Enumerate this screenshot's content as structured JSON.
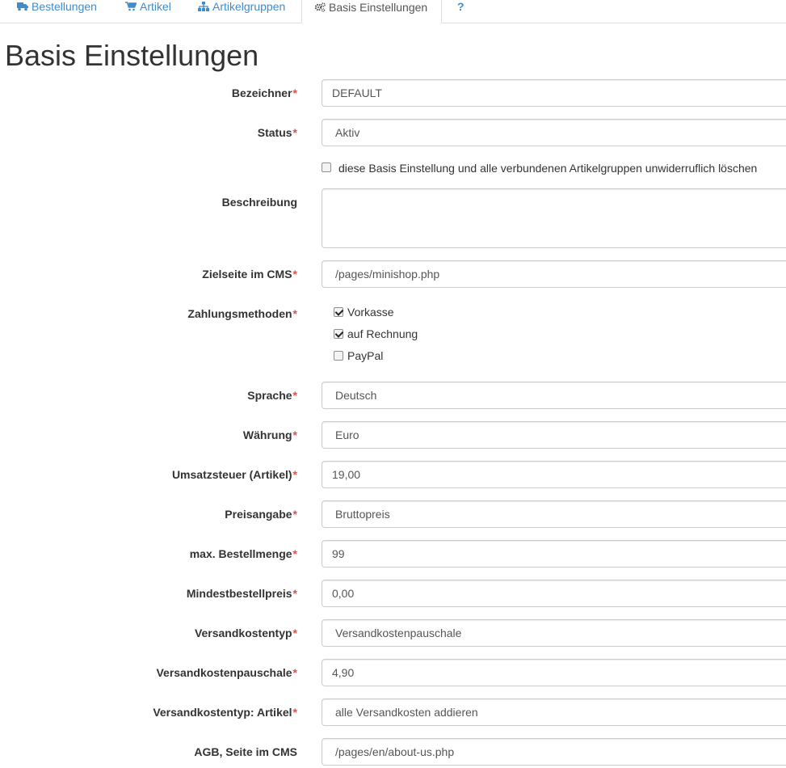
{
  "tabs": [
    {
      "label": "Bestellungen",
      "icon": "truck-icon"
    },
    {
      "label": "Artikel",
      "icon": "cart-icon"
    },
    {
      "label": "Artikelgruppen",
      "icon": "sitemap-icon"
    },
    {
      "label": "Basis Einstellungen",
      "icon": "gears-icon"
    },
    {
      "label": "?",
      "icon": ""
    }
  ],
  "page_title": "Basis Einstellungen",
  "required_mark": "*",
  "form": {
    "bezeichner": {
      "label": "Bezeichner",
      "value": "DEFAULT"
    },
    "status": {
      "label": "Status",
      "value": "Aktiv"
    },
    "delete_checkbox": {
      "label": "diese Basis Einstellung und alle verbundenen Artikelgruppen unwiderruflich löschen",
      "checked": false
    },
    "beschreibung": {
      "label": "Beschreibung",
      "value": ""
    },
    "zielseite": {
      "label": "Zielseite im CMS",
      "value": "/pages/minishop.php"
    },
    "zahlungsmethoden": {
      "label": "Zahlungsmethoden",
      "options": [
        {
          "label": "Vorkasse",
          "checked": true
        },
        {
          "label": "auf Rechnung",
          "checked": true
        },
        {
          "label": "PayPal",
          "checked": false
        }
      ]
    },
    "sprache": {
      "label": "Sprache",
      "value": "Deutsch"
    },
    "waehrung": {
      "label": "Währung",
      "value": "Euro"
    },
    "umsatzsteuer": {
      "label": "Umsatzsteuer (Artikel)",
      "value": "19,00"
    },
    "preisangabe": {
      "label": "Preisangabe",
      "value": "Bruttopreis"
    },
    "max_bestellmenge": {
      "label": "max. Bestellmenge",
      "value": "99"
    },
    "mindestbestellpreis": {
      "label": "Mindestbestellpreis",
      "value": "0,00"
    },
    "versandkostentyp": {
      "label": "Versandkostentyp",
      "value": "Versandkostenpauschale"
    },
    "versandkostenpauschale": {
      "label": "Versandkostenpauschale",
      "value": "4,90"
    },
    "versandkostentyp_artikel": {
      "label": "Versandkostentyp: Artikel",
      "value": "alle Versandkosten addieren"
    },
    "agb": {
      "label": "AGB, Seite im CMS",
      "value": "/pages/en/about-us.php"
    }
  },
  "colors": {
    "link": "#428bca",
    "required": "#d9534f",
    "border": "#cccccc"
  }
}
